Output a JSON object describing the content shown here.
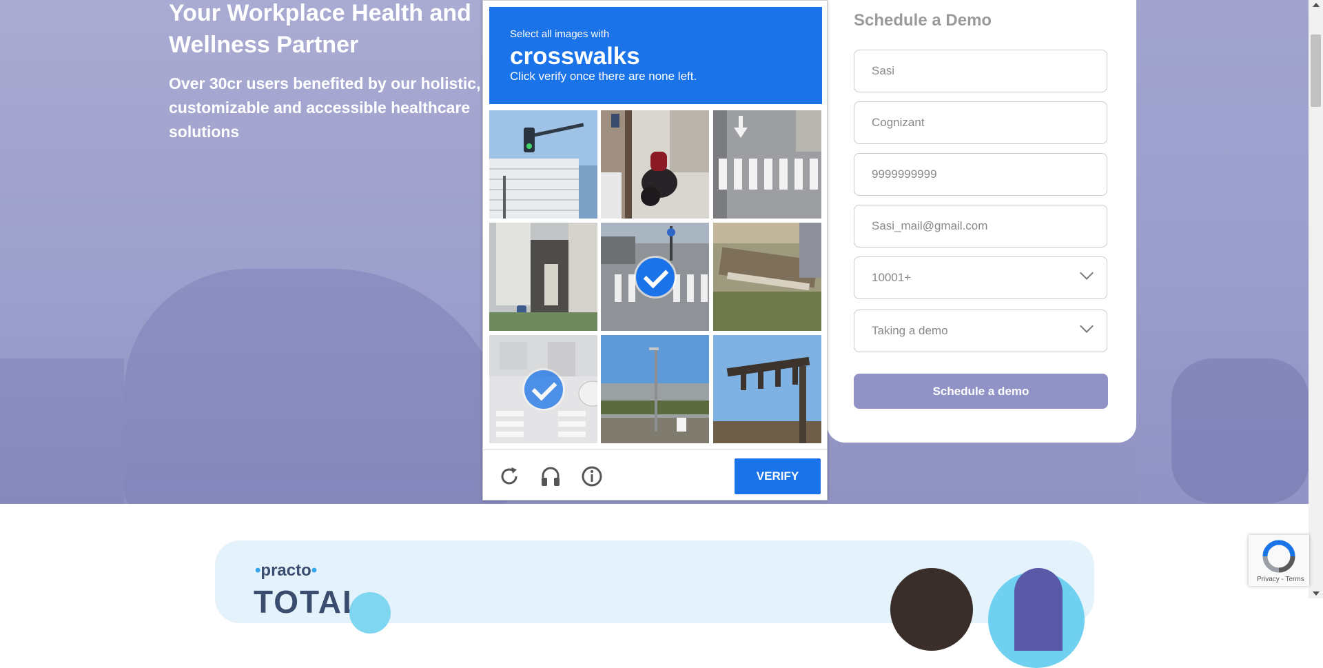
{
  "hero": {
    "title": "Your Workplace Health and Wellness Partner",
    "subtitle": "Over 30cr users benefited by our holistic, customizable and accessible healthcare solutions"
  },
  "form": {
    "title": "Schedule a Demo",
    "name_value": "Sasi",
    "company_value": "Cognizant",
    "phone_value": "9999999999",
    "email_value": "Sasi_mail@gmail.com",
    "employees_selected": "10001+",
    "interest_selected": "Taking a demo",
    "submit_label": "Schedule a demo"
  },
  "captcha": {
    "instruction_line1": "Select all images with",
    "keyword": "crosswalks",
    "instruction_line3": "Click verify once there are none left.",
    "tiles": [
      {
        "selected": false,
        "scene": "traffic-light-pole"
      },
      {
        "selected": false,
        "scene": "motorcycle-street"
      },
      {
        "selected": false,
        "scene": "crosswalk-road"
      },
      {
        "selected": false,
        "scene": "building-entrance"
      },
      {
        "selected": true,
        "scene": "crosswalk-intersection"
      },
      {
        "selected": false,
        "scene": "overgrown-lot"
      },
      {
        "selected": true,
        "scene": "faded-crosswalk"
      },
      {
        "selected": false,
        "scene": "streetlight-overpass"
      },
      {
        "selected": false,
        "scene": "sign-gantry"
      }
    ],
    "reload_icon": "reload-icon",
    "audio_icon": "headphones-icon",
    "info_icon": "info-icon",
    "verify_label": "VERIFY",
    "accent_color": "#1a73e8"
  },
  "lower": {
    "brand_name": "practo",
    "brand_product": "TOTAL"
  },
  "recaptcha_badge": {
    "links": "Privacy - Terms"
  }
}
